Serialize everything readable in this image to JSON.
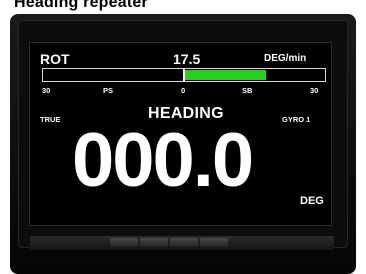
{
  "caption": "Heading repeater",
  "display": {
    "rot": {
      "title": "ROT",
      "value": "17.5",
      "unit": "DEG/min",
      "scale_left": "30",
      "port_label": "PS",
      "center_label": "0",
      "starboard_label": "SB",
      "scale_right": "30",
      "scale_min": -30,
      "scale_max": 30,
      "rate": 17.5,
      "bar_color": "#22d21f"
    },
    "true_label": "TRUE",
    "heading_label": "HEADING",
    "source_label": "GYRO 1",
    "heading_value": "000.0",
    "heading_unit": "DEG"
  }
}
